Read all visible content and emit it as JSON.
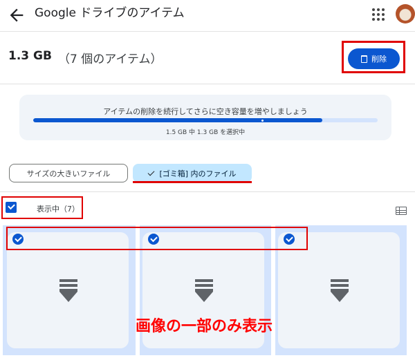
{
  "header": {
    "title": "Google ドライブのアイテム",
    "back_icon": "arrow-back-icon",
    "apps_icon": "apps-grid-icon",
    "avatar": "account-avatar"
  },
  "summary": {
    "size": "1.3 GB",
    "count": "（7 個のアイテム）",
    "delete_label": "削除"
  },
  "progress": {
    "message": "アイテムの削除を続行してさらに空き容量を増やしましょう",
    "fraction": 0.84,
    "sub": "1.5 GB 中 1.3 GB を選択中"
  },
  "tabs": [
    {
      "label": "サイズの大きいファイル",
      "selected": false
    },
    {
      "label": "[ゴミ箱] 内のファイル",
      "selected": true
    }
  ],
  "selection": {
    "label": "表示中（7）",
    "checked": true
  },
  "files": [
    {
      "selected": true,
      "icon": "drive-file-icon"
    },
    {
      "selected": true,
      "icon": "drive-file-icon"
    },
    {
      "selected": true,
      "icon": "drive-file-icon"
    }
  ],
  "annotation": "画像の一部のみ表示",
  "colors": {
    "accent": "#0b57d0",
    "highlight": "#e00000"
  }
}
